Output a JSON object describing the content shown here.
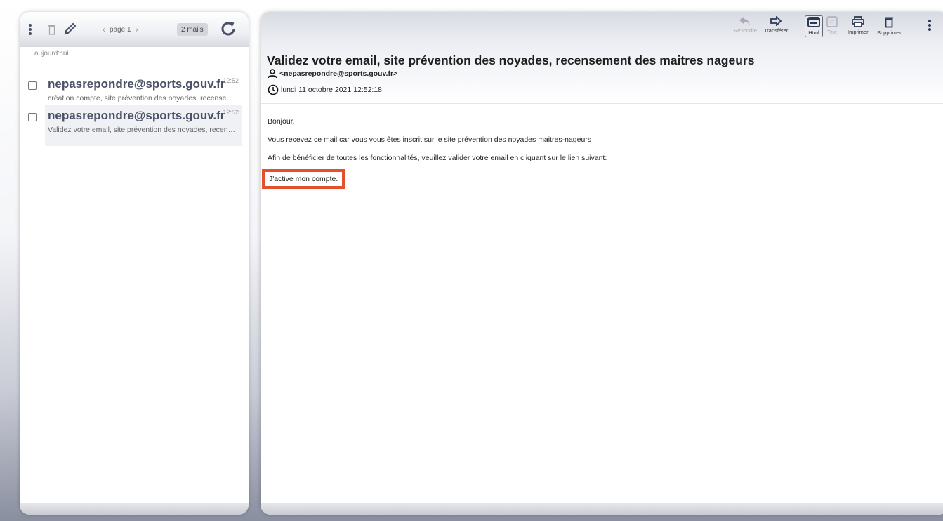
{
  "list_toolbar": {
    "page_label": "page 1",
    "mail_count": "2 mails"
  },
  "list": {
    "group_label": "aujourd'hui",
    "items": [
      {
        "from": "nepasrepondre@sports.gouv.fr",
        "time": "12:52",
        "subject": "création compte, site prévention des noyades, recensement des maitres nageurs"
      },
      {
        "from": "nepasrepondre@sports.gouv.fr",
        "time": "12:52",
        "subject": "Validez votre email, site prévention des noyades, recensement des maitres nageurs"
      }
    ]
  },
  "message_toolbar": {
    "reply": "Répondre",
    "forward": "Transférer",
    "html": "Html",
    "text": "Text",
    "print": "Imprimer",
    "delete": "Supprimer"
  },
  "message": {
    "subject": "Validez votre email, site prévention des noyades, recensement des maitres nageurs",
    "sender": "<nepasrepondre@sports.gouv.fr>",
    "date": "lundi 11 octobre 2021 12:52:18",
    "greeting": "Bonjour,",
    "line1": "Vous recevez ce mail car vous vous êtes inscrit sur le site prévention des noyades maitres-nageurs",
    "line2": "Afin de bénéficier de toutes les fonctionnalités, veuillez valider votre email en cliquant sur le lien suivant:",
    "link": "J'active mon compte."
  },
  "colors": {
    "highlight_border": "#e2502e",
    "sender_text": "#4a5166"
  },
  "icons": [
    "more-vertical-icon",
    "trash-icon",
    "pencil-icon",
    "refresh-icon",
    "reply-icon",
    "forward-icon",
    "html-view-icon",
    "text-view-icon",
    "print-icon",
    "user-icon",
    "clock-icon"
  ]
}
